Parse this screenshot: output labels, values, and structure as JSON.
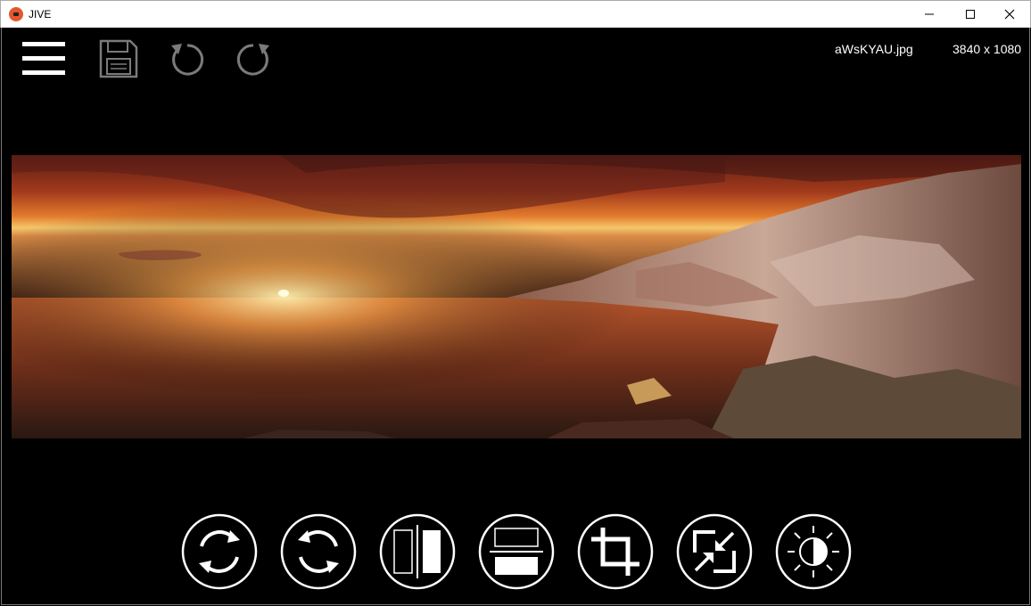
{
  "window": {
    "title": "JIVE"
  },
  "header": {
    "filename": "aWsKYAU.jpg",
    "dimensions": "3840 x 1080"
  },
  "icons": {
    "menu": "hamburger-menu-icon",
    "save": "floppy-disk-icon",
    "undo": "undo-icon",
    "redo": "redo-icon"
  },
  "toolbar": {
    "buttons": [
      "rotate-left",
      "rotate-right",
      "flip-horizontal",
      "flip-vertical",
      "crop",
      "resize",
      "brightness"
    ]
  },
  "colors": {
    "accent": "#e4572e",
    "icon": "#ffffff",
    "icon_disabled": "#7a7a7a",
    "background": "#000000"
  }
}
